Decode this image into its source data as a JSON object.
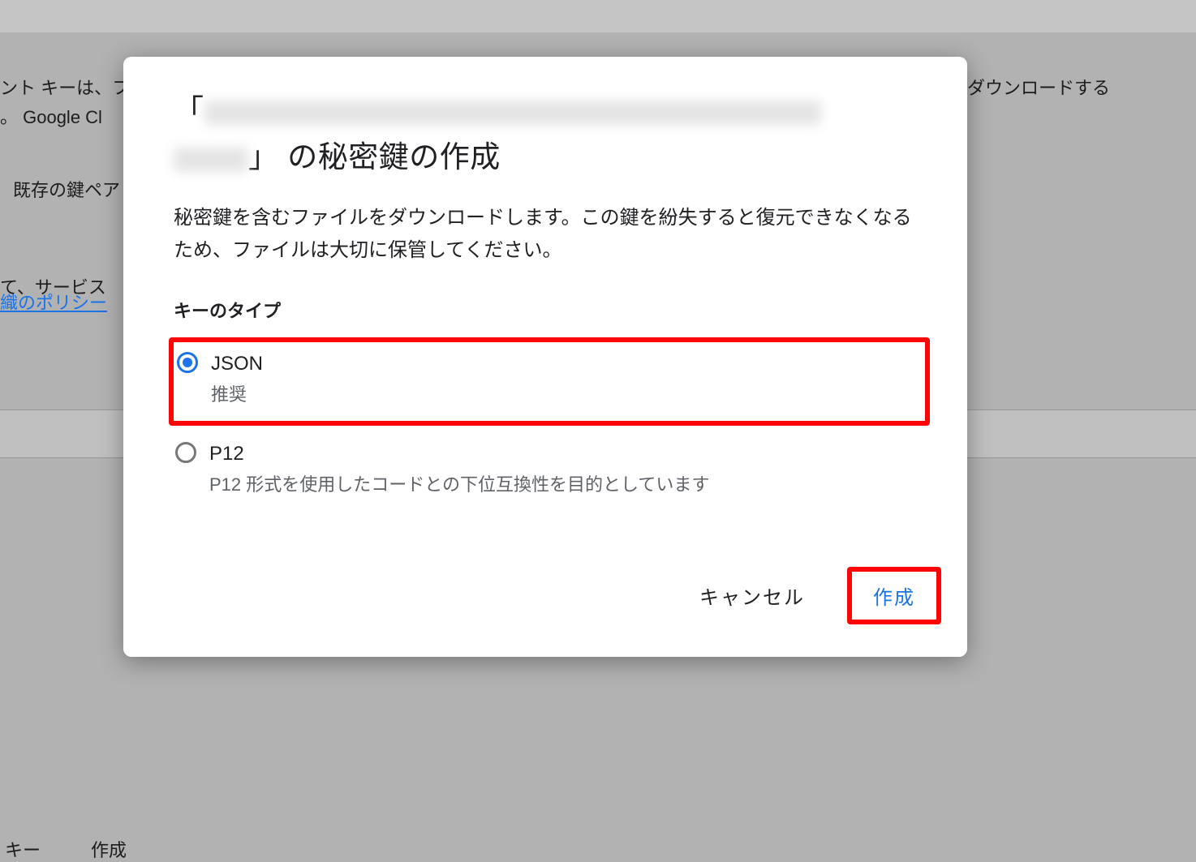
{
  "background": {
    "line1_left": "ント キーは、フ",
    "line1_right": "ダウンロードする",
    "line2": "。 Google Cl",
    "line3": "既存の鍵ペア",
    "line4": "て、サービス",
    "link": "織のポリシー",
    "tab_key": "キー",
    "tab_date": "作成"
  },
  "dialog": {
    "title_prefix": "「",
    "title_suffix": "」 の秘密鍵の作成",
    "description": "秘密鍵を含むファイルをダウンロードします。この鍵を紛失すると復元できなくなるため、ファイルは大切に保管してください。",
    "key_type_label": "キーのタイプ",
    "options": {
      "json": {
        "title": "JSON",
        "sub": "推奨"
      },
      "p12": {
        "title": "P12",
        "sub": "P12 形式を使用したコードとの下位互換性を目的としています"
      }
    },
    "actions": {
      "cancel": "キャンセル",
      "create": "作成"
    }
  }
}
